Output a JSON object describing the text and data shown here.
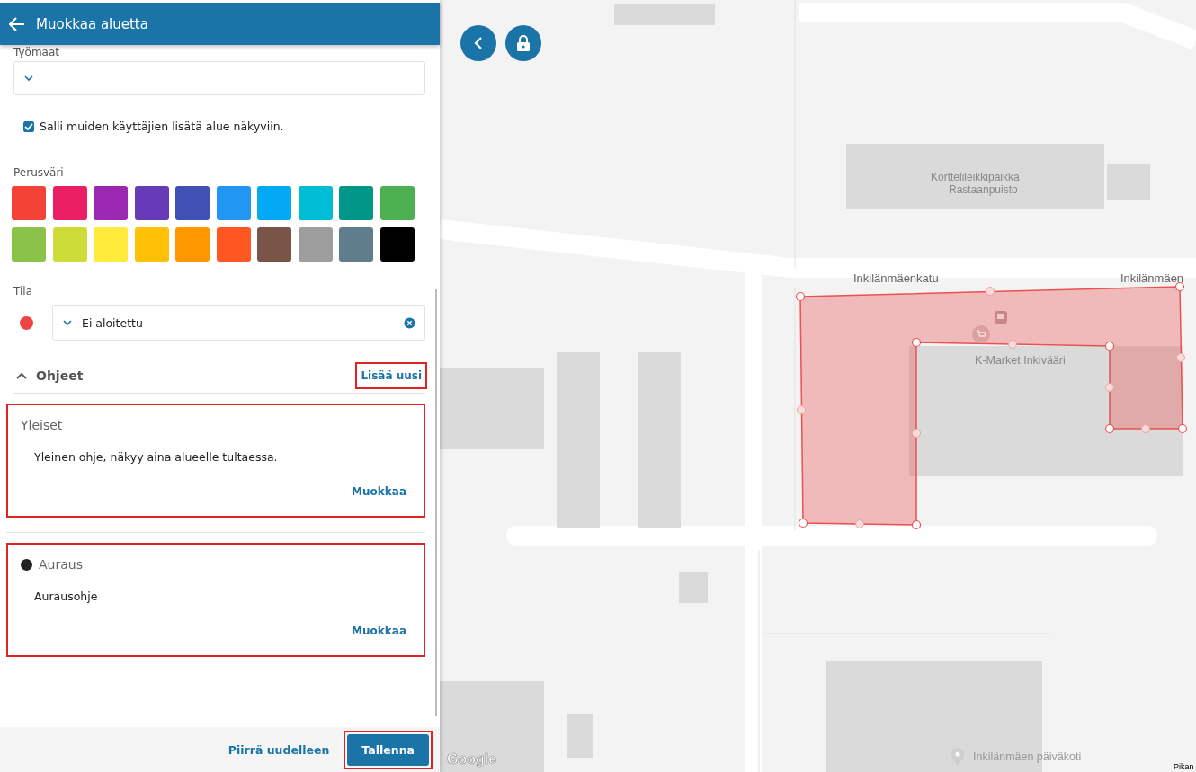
{
  "header": {
    "title": "Muokkaa aluetta"
  },
  "worksites": {
    "label": "Työmaat"
  },
  "share": {
    "label": "Salli muiden käyttäjien lisätä alue näkyviin.",
    "checked": true
  },
  "base_color": {
    "label": "Perusväri",
    "swatches": [
      {
        "color": "#f44336"
      },
      {
        "color": "#e91e63"
      },
      {
        "color": "#9c27b0"
      },
      {
        "color": "#673ab7"
      },
      {
        "color": "#3f51b5"
      },
      {
        "color": "#2196f3"
      },
      {
        "color": "#03a9f4"
      },
      {
        "color": "#00bcd4"
      },
      {
        "color": "#009688"
      },
      {
        "color": "#4caf50"
      },
      {
        "color": "#8bc34a"
      },
      {
        "color": "#cddc39"
      },
      {
        "color": "#ffeb3b"
      },
      {
        "color": "#ffc107"
      },
      {
        "color": "#ff9800"
      },
      {
        "color": "#ff5722"
      },
      {
        "color": "#795548"
      },
      {
        "color": "#9e9e9e"
      },
      {
        "color": "#607d8b"
      },
      {
        "color": "#000000"
      }
    ]
  },
  "status": {
    "label": "Tila",
    "color": "#ef4444",
    "value": "Ei aloitettu"
  },
  "instructions": {
    "title": "Ohjeet",
    "expanded": true,
    "add_action": {
      "label": "Lisää uusi",
      "highlighted": true
    },
    "items": [
      {
        "title": "Yleiset",
        "text": "Yleinen ohje, näkyy aina alueelle tultaessa.",
        "action": "Muokkaa",
        "highlighted": true
      },
      {
        "title": "Auraus",
        "color": "#222222",
        "text": "Aurausohje",
        "action": "Muokkaa",
        "highlighted": true
      }
    ]
  },
  "footer": {
    "secondary": {
      "label": "Piirrä uudelleen",
      "highlighted": false
    },
    "primary": {
      "label": "Tallenna",
      "highlighted": true
    }
  },
  "map": {
    "labels": [
      {
        "kind": "place",
        "text": "Korttelileikkipaikka"
      },
      {
        "kind": "place",
        "text": "Rastaanpuisto"
      },
      {
        "kind": "street",
        "text": "Inkilänmäenkatu"
      },
      {
        "kind": "street",
        "text": "Inkilänmäen"
      },
      {
        "kind": "poi",
        "text": "K-Market Inkivääri"
      },
      {
        "kind": "logo",
        "text": "Google"
      },
      {
        "kind": "pin",
        "text": "Inkilänmäen päiväkoti"
      },
      {
        "kind": "corner",
        "text": "Pikan"
      }
    ]
  }
}
